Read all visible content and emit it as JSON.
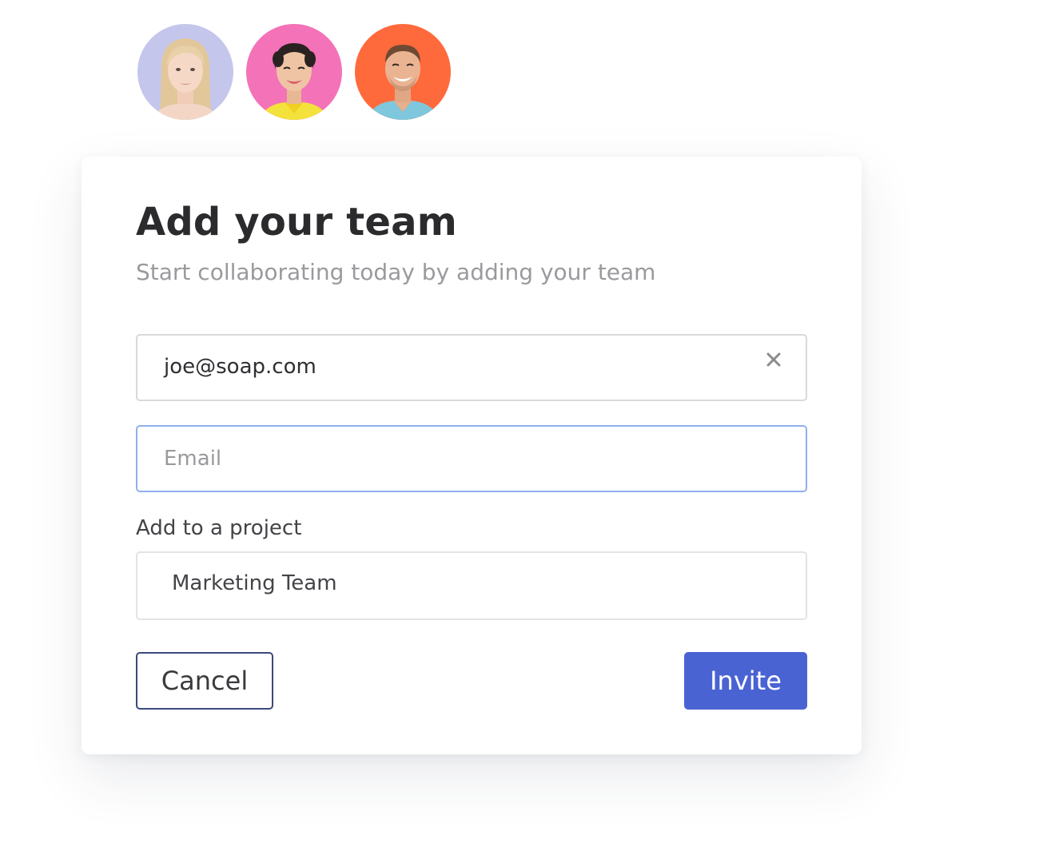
{
  "team_avatars": [
    {
      "name": "avatar-woman-blonde",
      "bg_color": "#c5c6ec"
    },
    {
      "name": "avatar-woman-dark-hair",
      "bg_color": "#f472b8"
    },
    {
      "name": "avatar-man-smiling",
      "bg_color": "#ff6a3d"
    }
  ],
  "dialog": {
    "title": "Add your team",
    "subtitle": "Start collaborating today by adding your team"
  },
  "invite_list": {
    "entered_email": "joe@soap.com",
    "clear_icon": "close-icon"
  },
  "email_input": {
    "placeholder": "Email",
    "value": ""
  },
  "project": {
    "label": "Add to a project",
    "selected": "Marketing Team"
  },
  "actions": {
    "cancel_label": "Cancel",
    "invite_label": "Invite"
  },
  "colors": {
    "accent": "#4a63d3",
    "focus_border": "#8fb0ec",
    "cancel_border": "#3b4a7a"
  }
}
